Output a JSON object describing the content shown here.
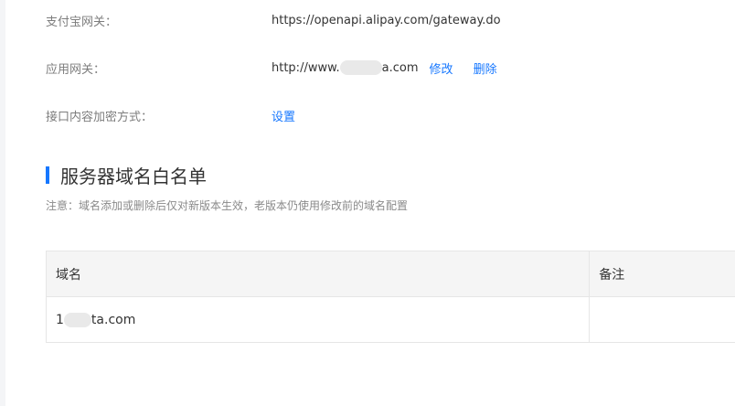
{
  "config": {
    "alipay_gateway": {
      "label": "支付宝网关：",
      "value": "https://openapi.alipay.com/gateway.do"
    },
    "app_gateway": {
      "label": "应用网关：",
      "value_prefix": "http://www.",
      "value_suffix": "a.com",
      "edit_label": "修改",
      "delete_label": "删除"
    },
    "encryption": {
      "label": "接口内容加密方式：",
      "set_label": "设置"
    }
  },
  "whitelist": {
    "title": "服务器域名白名单",
    "note": "注意：域名添加或删除后仅对新版本生效，老版本仍使用修改前的域名配置",
    "columns": [
      "域名",
      "备注"
    ],
    "rows": [
      {
        "domain_prefix": "1",
        "domain_suffix": "ta.com",
        "remark": ""
      }
    ]
  },
  "colors": {
    "accent": "#1677ff",
    "label": "#7d7d7d",
    "header_bg": "#f5f5f5",
    "border": "#e6e6e6"
  }
}
